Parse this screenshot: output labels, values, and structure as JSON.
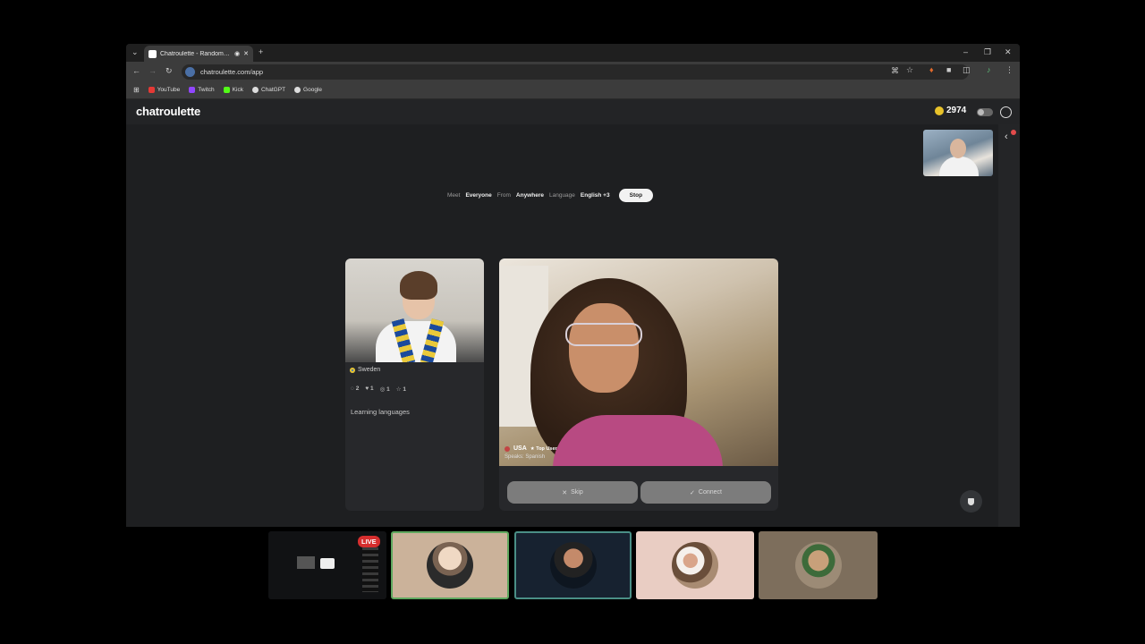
{
  "browser": {
    "tab_title": "Chatroulette - Random vid",
    "url": "chatroulette.com/app",
    "bookmarks": [
      {
        "label": "YouTube",
        "color": "#e53935"
      },
      {
        "label": "Twitch",
        "color": "#9146ff"
      },
      {
        "label": "Kick",
        "color": "#53fc18"
      },
      {
        "label": "ChatGPT",
        "color": "#dddddd"
      },
      {
        "label": "Google",
        "color": "#dddddd"
      }
    ]
  },
  "app": {
    "logo": "chatroulette",
    "coins": "2974",
    "filters": {
      "meet_label": "Meet",
      "meet_value": "Everyone",
      "from_label": "From",
      "from_value": "Anywhere",
      "language_label": "Language",
      "language_value": "English +3",
      "stop_label": "Stop"
    },
    "profile": {
      "country": "Sweden",
      "stats": [
        "2",
        "1",
        "1",
        "1"
      ],
      "interests": "Learning languages"
    },
    "partner": {
      "country": "USA",
      "badge": "Top User",
      "speaks": "Speaks: Spanish"
    },
    "actions": {
      "skip": "Skip",
      "connect": "Connect"
    }
  },
  "stream": {
    "live_label": "LIVE"
  },
  "colors": {
    "accent_coin": "#e8c22a",
    "live_red": "#d62e2e",
    "page_bg": "#1e1f21"
  }
}
